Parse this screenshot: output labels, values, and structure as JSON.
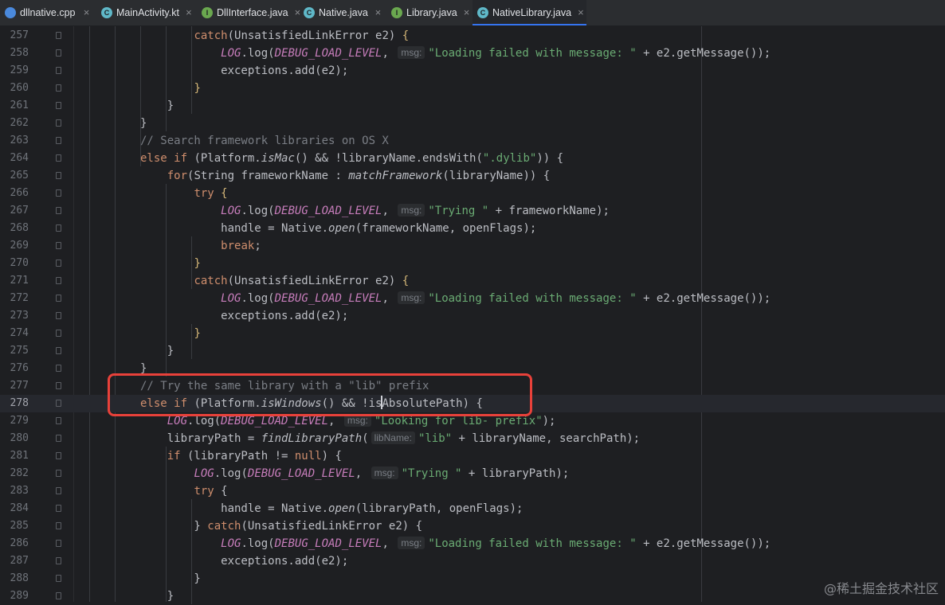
{
  "tabs": [
    {
      "label": "dllnative.cpp",
      "icon": "cpp-file-icon",
      "icon_text": "",
      "icon_color": "#4a89dc",
      "active": false
    },
    {
      "label": "MainActivity.kt",
      "icon": "kotlin-class-icon",
      "icon_text": "C",
      "icon_color": "#5fb8c8",
      "active": false
    },
    {
      "label": "DllInterface.java",
      "icon": "java-interface-icon",
      "icon_text": "I",
      "icon_color": "#6aa84f",
      "active": false
    },
    {
      "label": "Native.java",
      "icon": "java-class-icon",
      "icon_text": "C",
      "icon_color": "#5fb8c8",
      "active": false
    },
    {
      "label": "Library.java",
      "icon": "java-interface-icon",
      "icon_text": "I",
      "icon_color": "#6aa84f",
      "active": false
    },
    {
      "label": "NativeLibrary.java",
      "icon": "java-class-icon",
      "icon_text": "C",
      "icon_color": "#5fb8c8",
      "active": true
    }
  ],
  "close_glyph": "×",
  "current_line": 278,
  "watermark": "@稀土掘金技术社区",
  "colors": {
    "accent": "#3574f0",
    "highlight_box": "#e8413a",
    "background": "#1e1f22"
  },
  "lines": [
    {
      "n": "257",
      "t": [
        [
          "        ",
          ""
        ],
        [
          "catch",
          "kw"
        ],
        [
          "(UnsatisfiedLinkError e2) ",
          ""
        ],
        [
          "{",
          "p1"
        ]
      ]
    },
    {
      "n": "258",
      "t": [
        [
          "            ",
          ""
        ],
        [
          "LOG",
          "const"
        ],
        [
          ".log(",
          ""
        ],
        [
          "DEBUG_LOAD_LEVEL",
          "const"
        ],
        [
          ", ",
          ""
        ],
        [
          "msg:",
          "hint"
        ],
        [
          "\"Loading failed with message: \"",
          "str"
        ],
        [
          " + e2.getMessage());",
          ""
        ]
      ]
    },
    {
      "n": "259",
      "t": [
        [
          "            exceptions.add(e2);",
          ""
        ]
      ]
    },
    {
      "n": "260",
      "t": [
        [
          "        ",
          ""
        ],
        [
          "}",
          "p1"
        ]
      ]
    },
    {
      "n": "261",
      "t": [
        [
          "    }",
          ""
        ]
      ]
    },
    {
      "n": "262",
      "t": [
        [
          "}",
          ""
        ]
      ]
    },
    {
      "n": "263",
      "t": [
        [
          "// Search framework libraries on OS X",
          "cmt"
        ]
      ]
    },
    {
      "n": "264",
      "t": [
        [
          "else if",
          "kw"
        ],
        [
          " (Platform.",
          ""
        ],
        [
          "isMac",
          "stat"
        ],
        [
          "() && !libraryName.endsWith(",
          ""
        ],
        [
          "\".dylib\"",
          "str"
        ],
        [
          ")) {",
          ""
        ]
      ]
    },
    {
      "n": "265",
      "t": [
        [
          "    ",
          ""
        ],
        [
          "for",
          "kw"
        ],
        [
          "(String frameworkName : ",
          ""
        ],
        [
          "matchFramework",
          "stat"
        ],
        [
          "(libraryName)) {",
          ""
        ]
      ]
    },
    {
      "n": "266",
      "t": [
        [
          "        ",
          ""
        ],
        [
          "try",
          "kw"
        ],
        [
          " ",
          ""
        ],
        [
          "{",
          "p1"
        ]
      ]
    },
    {
      "n": "267",
      "t": [
        [
          "            ",
          ""
        ],
        [
          "LOG",
          "const"
        ],
        [
          ".log(",
          ""
        ],
        [
          "DEBUG_LOAD_LEVEL",
          "const"
        ],
        [
          ", ",
          ""
        ],
        [
          "msg:",
          "hint"
        ],
        [
          "\"Trying \"",
          "str"
        ],
        [
          " + frameworkName);",
          ""
        ]
      ]
    },
    {
      "n": "268",
      "t": [
        [
          "            handle = Native.",
          ""
        ],
        [
          "open",
          "stat"
        ],
        [
          "(frameworkName, openFlags);",
          ""
        ]
      ]
    },
    {
      "n": "269",
      "t": [
        [
          "            ",
          ""
        ],
        [
          "break",
          "kw"
        ],
        [
          ";",
          ""
        ]
      ]
    },
    {
      "n": "270",
      "t": [
        [
          "        ",
          ""
        ],
        [
          "}",
          "p1"
        ]
      ]
    },
    {
      "n": "271",
      "t": [
        [
          "        ",
          ""
        ],
        [
          "catch",
          "kw"
        ],
        [
          "(UnsatisfiedLinkError e2) ",
          ""
        ],
        [
          "{",
          "p1"
        ]
      ]
    },
    {
      "n": "272",
      "t": [
        [
          "            ",
          ""
        ],
        [
          "LOG",
          "const"
        ],
        [
          ".log(",
          ""
        ],
        [
          "DEBUG_LOAD_LEVEL",
          "const"
        ],
        [
          ", ",
          ""
        ],
        [
          "msg:",
          "hint"
        ],
        [
          "\"Loading failed with message: \"",
          "str"
        ],
        [
          " + e2.getMessage());",
          ""
        ]
      ]
    },
    {
      "n": "273",
      "t": [
        [
          "            exceptions.add(e2);",
          ""
        ]
      ]
    },
    {
      "n": "274",
      "t": [
        [
          "        ",
          ""
        ],
        [
          "}",
          "p1"
        ]
      ]
    },
    {
      "n": "275",
      "t": [
        [
          "    }",
          ""
        ]
      ]
    },
    {
      "n": "276",
      "t": [
        [
          "}",
          ""
        ]
      ]
    },
    {
      "n": "277",
      "t": [
        [
          "// Try the same library with a \"lib\" prefix",
          "cmt"
        ]
      ]
    },
    {
      "n": "278",
      "t": [
        [
          "else if",
          "kw"
        ],
        [
          " (Platform.",
          ""
        ],
        [
          "isWindows",
          "stat"
        ],
        [
          "() && !is",
          ""
        ],
        [
          "|",
          "caret"
        ],
        [
          "AbsolutePath) {",
          ""
        ]
      ]
    },
    {
      "n": "279",
      "t": [
        [
          "    ",
          ""
        ],
        [
          "LOG",
          "const"
        ],
        [
          ".log(",
          ""
        ],
        [
          "DEBUG_LOAD_LEVEL",
          "const"
        ],
        [
          ", ",
          ""
        ],
        [
          "msg:",
          "hint"
        ],
        [
          "\"Looking for lib- prefix\"",
          "str"
        ],
        [
          ");",
          ""
        ]
      ]
    },
    {
      "n": "280",
      "t": [
        [
          "    libraryPath = ",
          ""
        ],
        [
          "findLibraryPath",
          "stat"
        ],
        [
          "(",
          ""
        ],
        [
          "libName:",
          "hint"
        ],
        [
          "\"lib\"",
          "str"
        ],
        [
          " + libraryName, searchPath);",
          ""
        ]
      ]
    },
    {
      "n": "281",
      "t": [
        [
          "    ",
          ""
        ],
        [
          "if",
          "kw"
        ],
        [
          " (libraryPath != ",
          ""
        ],
        [
          "null",
          "kw"
        ],
        [
          ") {",
          ""
        ]
      ]
    },
    {
      "n": "282",
      "t": [
        [
          "        ",
          ""
        ],
        [
          "LOG",
          "const"
        ],
        [
          ".log(",
          ""
        ],
        [
          "DEBUG_LOAD_LEVEL",
          "const"
        ],
        [
          ", ",
          ""
        ],
        [
          "msg:",
          "hint"
        ],
        [
          "\"Trying \"",
          "str"
        ],
        [
          " + libraryPath);",
          ""
        ]
      ]
    },
    {
      "n": "283",
      "t": [
        [
          "        ",
          ""
        ],
        [
          "try",
          "kw"
        ],
        [
          " {",
          ""
        ]
      ]
    },
    {
      "n": "284",
      "t": [
        [
          "            handle = Native.",
          ""
        ],
        [
          "open",
          "stat"
        ],
        [
          "(libraryPath, openFlags);",
          ""
        ]
      ]
    },
    {
      "n": "285",
      "t": [
        [
          "        } ",
          ""
        ],
        [
          "catch",
          "kw"
        ],
        [
          "(UnsatisfiedLinkError e2) {",
          ""
        ]
      ]
    },
    {
      "n": "286",
      "t": [
        [
          "            ",
          ""
        ],
        [
          "LOG",
          "const"
        ],
        [
          ".log(",
          ""
        ],
        [
          "DEBUG_LOAD_LEVEL",
          "const"
        ],
        [
          ", ",
          ""
        ],
        [
          "msg:",
          "hint"
        ],
        [
          "\"Loading failed with message: \"",
          "str"
        ],
        [
          " + e2.getMessage());",
          ""
        ]
      ]
    },
    {
      "n": "287",
      "t": [
        [
          "            exceptions.add(e2);",
          ""
        ]
      ]
    },
    {
      "n": "288",
      "t": [
        [
          "        }",
          ""
        ]
      ]
    },
    {
      "n": "289",
      "t": [
        [
          "    }",
          ""
        ]
      ]
    }
  ]
}
